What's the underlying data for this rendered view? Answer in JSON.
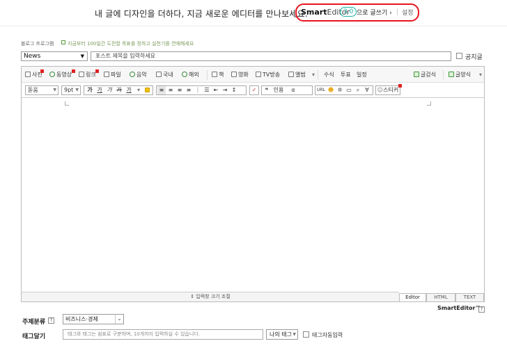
{
  "banner": {
    "text": "내 글에 디자인을 더하다, 지금 새로운 에디터를 만나보세요.",
    "brand_bold": "Smart",
    "brand_light": "Editor",
    "version": "3.0",
    "write_link": "으로 글쓰기 ›",
    "settings_link": "설정",
    "accent_color": "#e8141e"
  },
  "meta": {
    "label": "블로그 프로그램",
    "description": "지금부터 100일간 도전할 목표를 정하고 실천기를 연재해세요"
  },
  "post": {
    "category": "News",
    "title_placeholder": "포스트 제목을 입력하세요",
    "notice_label": "공지글"
  },
  "toolbar1": {
    "photo": "사진",
    "video": "동영상",
    "link": "링크",
    "file": "파일",
    "music": "음악",
    "domestic": "국내",
    "overseas": "해외",
    "book": "책",
    "movie": "영화",
    "tv": "TV방송",
    "album": "앨범",
    "formula": "수식",
    "vote": "투표",
    "schedule": "일정",
    "quote_style": "글감식",
    "layout_style": "글양식"
  },
  "toolbar2": {
    "font": "돋움",
    "size": "9pt",
    "bold": "가",
    "italic": "가",
    "strike": "가",
    "sup": "가",
    "underline": "가",
    "quote": "❝",
    "quote2": "인용",
    "special": "α",
    "url": "URL",
    "sticker": "스티커"
  },
  "editor": {
    "resize_label": "⇕ 입력창 크기 조절",
    "tabs": [
      "Editor",
      "HTML",
      "TEXT"
    ],
    "footer_brand": "SmartEditor™"
  },
  "subject": {
    "label": "주제분류",
    "value": "비즈니스·경제"
  },
  "tags": {
    "label": "태그달기",
    "placeholder": "태그와 태그는 쉼표로 구분하며, 10개까지 입력하실 수 있습니다.",
    "my_tags": "나의 태그",
    "auto_tag": "태그자동입력"
  }
}
